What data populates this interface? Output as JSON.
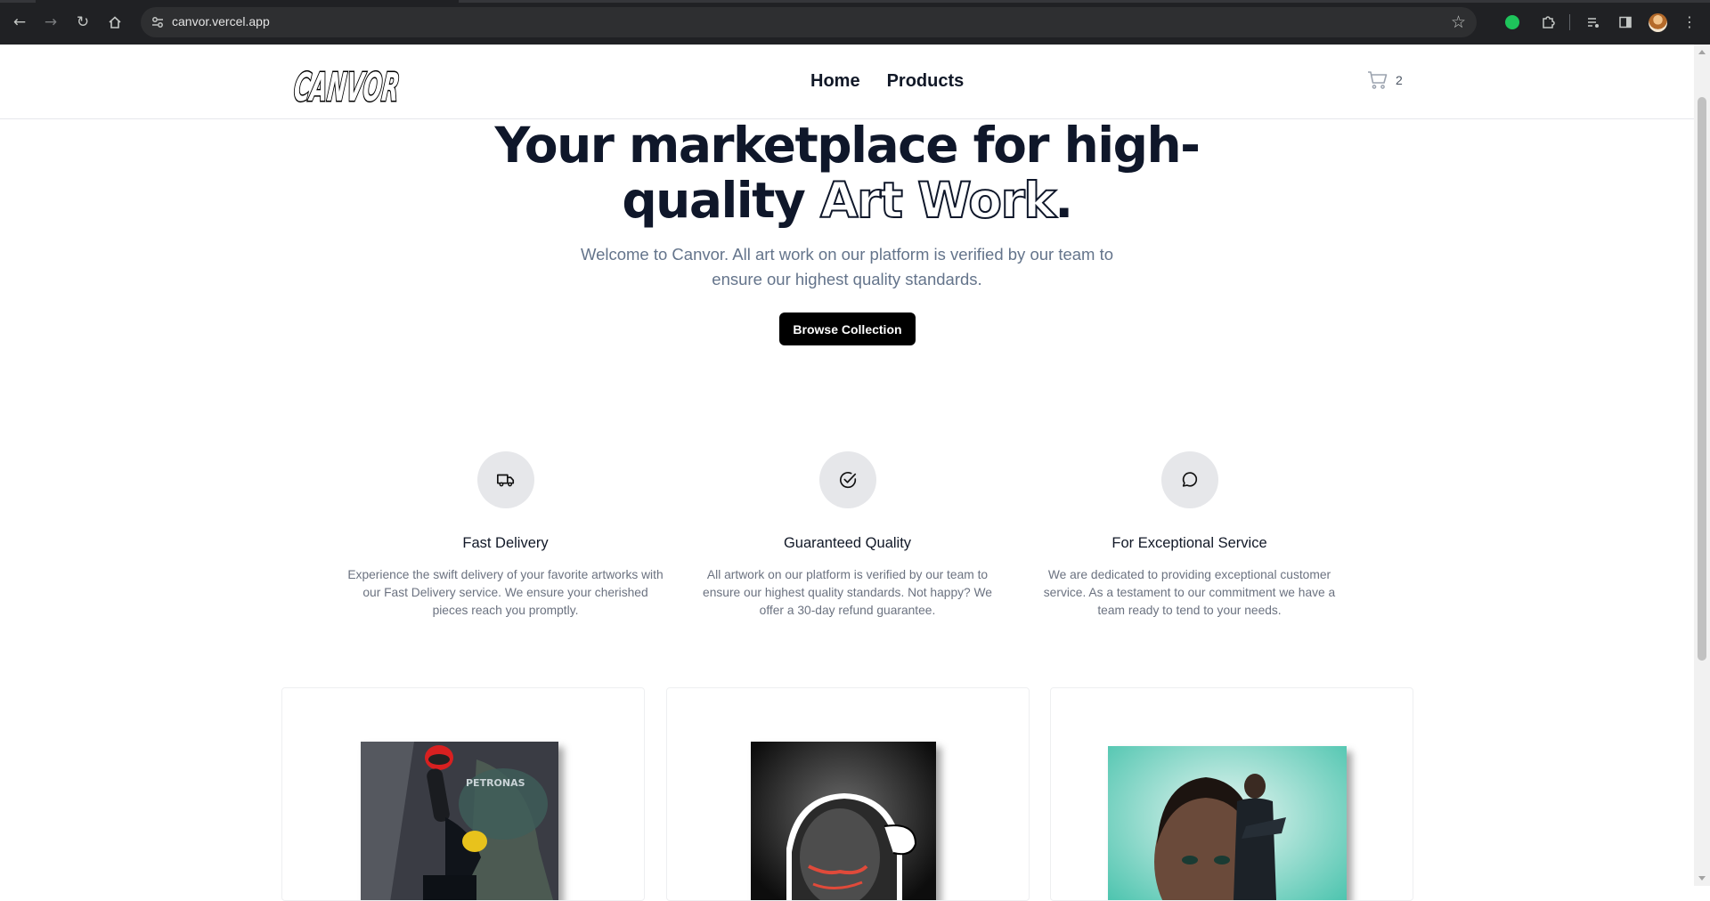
{
  "browser": {
    "url": "canvor.vercel.app"
  },
  "header": {
    "logo_text": "CANVOR",
    "nav": [
      "Home",
      "Products"
    ],
    "cart_count": "2"
  },
  "hero": {
    "title_line1": "Your marketplace for high-",
    "title_line2_plain": "quality ",
    "title_line2_outline": "Art Work",
    "title_period": ".",
    "subtitle": "Welcome to Canvor. All art work on our platform is verified by our team to ensure our highest quality standards.",
    "button_label": "Browse Collection"
  },
  "features": [
    {
      "icon": "truck-icon",
      "title": "Fast Delivery",
      "description": "Experience the swift delivery of your favorite artworks with our Fast Delivery service. We ensure your cherished pieces reach you promptly."
    },
    {
      "icon": "check-circle-icon",
      "title": "Guaranteed Quality",
      "description": "All artwork on our platform is verified by our team to ensure our highest quality standards. Not happy? We offer a 30-day refund guarantee."
    },
    {
      "icon": "chat-bubble-icon",
      "title": "For Exceptional Service",
      "description": "We are dedicated to providing exceptional customer service. As a testament to our commitment we have a team ready to tend to your needs."
    }
  ],
  "products": [
    {
      "name": "product-card-1",
      "printed_text": "PETRONAS"
    },
    {
      "name": "product-card-2"
    },
    {
      "name": "product-card-3"
    }
  ],
  "colors": {
    "text_dark": "#0f172a",
    "text_muted": "#64748b",
    "button_bg": "#000000",
    "icon_circle": "#e6e7ea"
  }
}
